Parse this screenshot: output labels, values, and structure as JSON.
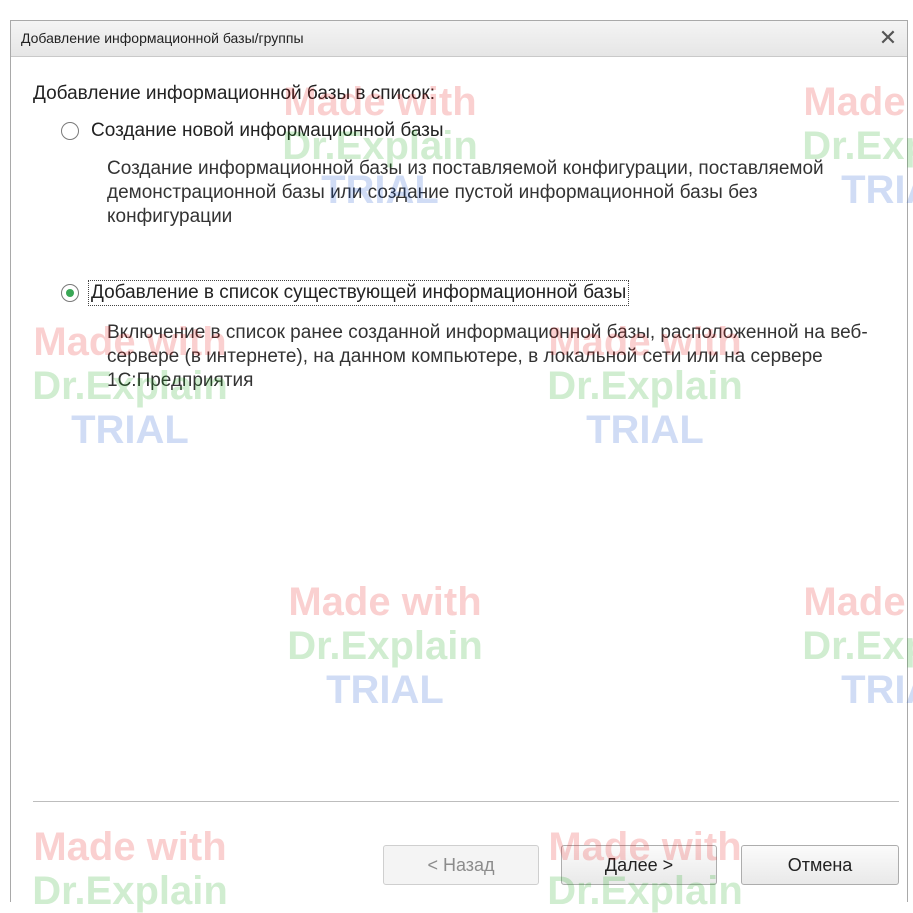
{
  "window": {
    "title": "Добавление информационной базы/группы",
    "close_glyph": "✕"
  },
  "heading": "Добавление информационной базы в список:",
  "options": [
    {
      "label": "Создание новой информационной базы",
      "checked": false,
      "description": "Создание информационной базы из поставляемой конфигурации, поставляемой демонстрационной базы или создание пустой информационной базы без конфигурации"
    },
    {
      "label": "Добавление в список существующей информационной базы",
      "checked": true,
      "description": "Включение в список ранее созданной информационной базы, расположенной на веб-сервере (в интернете), на данном компьютере,  в локальной сети или на сервере 1С:Предприятия"
    }
  ],
  "buttons": {
    "back": "< Назад",
    "next": "Далее >",
    "cancel": "Отмена"
  },
  "watermark": {
    "line1": "Made with",
    "line2": "Dr.Explain",
    "line3": "TRIAL"
  },
  "colors": {
    "radio_checked": "#3aa756"
  }
}
